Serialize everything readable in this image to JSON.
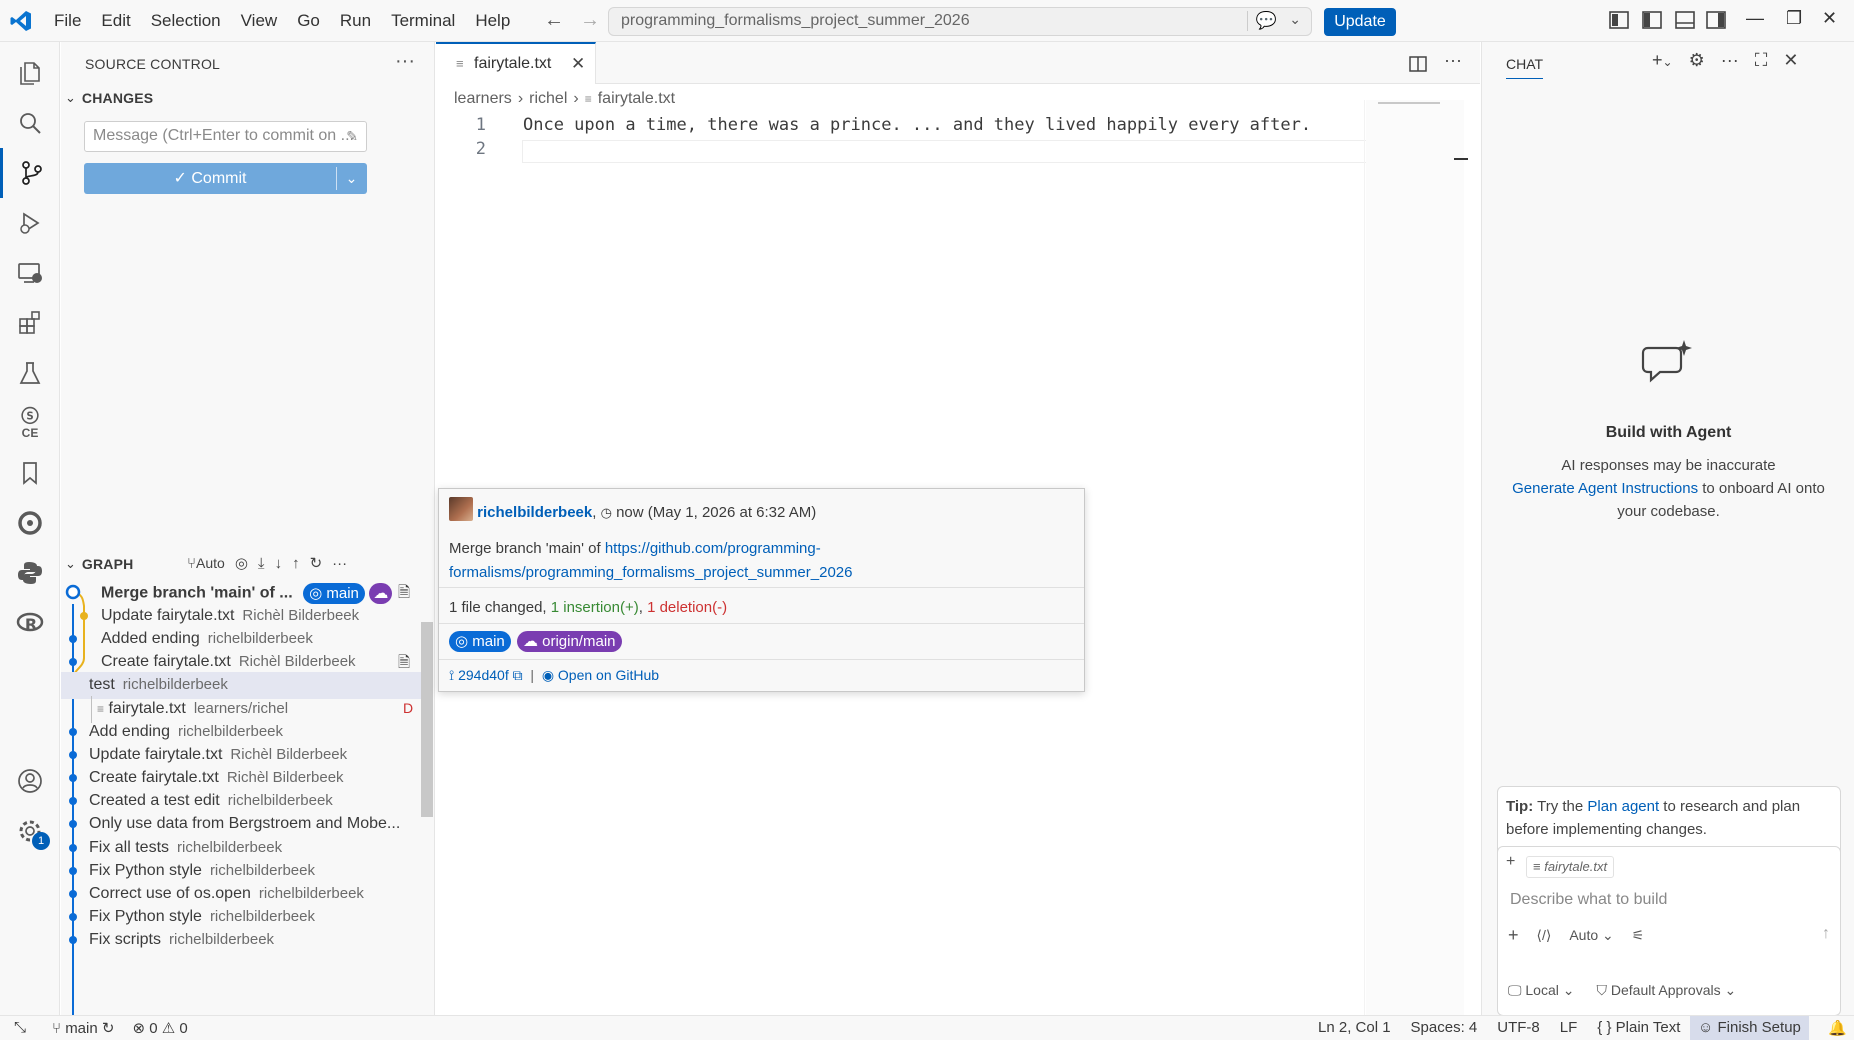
{
  "titlebar": {
    "menu": [
      "File",
      "Edit",
      "Selection",
      "View",
      "Go",
      "Run",
      "Terminal",
      "Help"
    ],
    "search_text": "programming_formalisms_project_summer_2026",
    "update_label": "Update"
  },
  "activitybar": {
    "items": [
      "explorer-icon",
      "search-icon",
      "source-control-icon",
      "run-debug-icon",
      "remote-explorer-icon",
      "extensions-icon",
      "testing-icon",
      "ce-icon",
      "bookmarks-icon",
      "gitlens-icon",
      "python-icon",
      "r-icon"
    ],
    "ce_label": "CE",
    "settings_badge": "1"
  },
  "source_control": {
    "title": "SOURCE CONTROL",
    "changes_label": "CHANGES",
    "message_placeholder": "Message (Ctrl+Enter to commit on ...",
    "commit_label": "Commit"
  },
  "graph": {
    "title": "GRAPH",
    "auto_label": "Auto",
    "rows": [
      {
        "msg": "Merge branch 'main' of ...",
        "author": "",
        "bold": true
      },
      {
        "msg": "Update fairytale.txt",
        "author": "Richèl Bilderbeek"
      },
      {
        "msg": "Added ending",
        "author": "richelbilderbeek"
      },
      {
        "msg": "Create fairytale.txt",
        "author": "Richèl Bilderbeek"
      },
      {
        "msg": "test",
        "author": "richelbilderbeek"
      },
      {
        "msg": "fairytale.txt",
        "author": "learners/richel",
        "status": "D"
      },
      {
        "msg": "Add ending",
        "author": "richelbilderbeek"
      },
      {
        "msg": "Update fairytale.txt",
        "author": "Richèl Bilderbeek"
      },
      {
        "msg": "Create fairytale.txt",
        "author": "Richèl Bilderbeek"
      },
      {
        "msg": "Created a test edit",
        "author": "richelbilderbeek"
      },
      {
        "msg": "Only use data from Bergstroem and Mobe...",
        "author": ""
      },
      {
        "msg": "Fix all tests",
        "author": "richelbilderbeek"
      },
      {
        "msg": "Fix Python style",
        "author": "richelbilderbeek"
      },
      {
        "msg": "Correct use of os.open",
        "author": "richelbilderbeek"
      },
      {
        "msg": "Fix Python style",
        "author": "richelbilderbeek"
      },
      {
        "msg": "Fix scripts",
        "author": "richelbilderbeek"
      }
    ],
    "branch_pill": "main"
  },
  "editor": {
    "tab_label": "fairytale.txt",
    "breadcrumb": [
      "learners",
      "richel",
      "fairytale.txt"
    ],
    "line_numbers": [
      "1",
      "2"
    ],
    "lines": [
      "Once upon a time, there was a prince. ... and they lived happily every after.",
      ""
    ]
  },
  "hover": {
    "author": "richelbilderbeek",
    "time": "now (May 1, 2026 at 6:32 AM)",
    "message_prefix": "Merge branch 'main' of ",
    "link_line1": "https://github.com/programming-",
    "link_line2": "formalisms/programming_formalisms_project_summer_2026",
    "files_changed": "1 file changed, ",
    "insertions": "1 insertion(+)",
    "sep": ", ",
    "deletions": "1 deletion(-)",
    "branch": "main",
    "remote": "origin/main",
    "sha": "294d40f",
    "open_label": "Open on GitHub"
  },
  "chat": {
    "title": "CHAT",
    "heading": "Build with Agent",
    "desc_1": "AI responses may be inaccurate",
    "desc_link": "Generate Agent Instructions",
    "desc_2": " to onboard AI onto your codebase.",
    "tip_label": "Tip:",
    "tip_1": " Try the ",
    "tip_link": "Plan agent",
    "tip_2": " to research and plan before implementing changes.",
    "attached_file": "fairytale.txt",
    "input_placeholder": "Describe what to build",
    "mode_label": "Auto",
    "footer_local": "Local",
    "footer_approvals": "Default Approvals"
  },
  "statusbar": {
    "branch": "main",
    "errors": "0",
    "warnings": "0",
    "position": "Ln 2, Col 1",
    "spaces": "Spaces: 4",
    "encoding": "UTF-8",
    "eol": "LF",
    "language": "Plain Text",
    "finish": "Finish Setup"
  },
  "colors": {
    "accent": "#005fb8",
    "main_pill": "#0a6bd6",
    "origin_pill": "#7a3db1",
    "graph_blue": "#0a6bd6",
    "graph_yellow": "#e8b21e"
  }
}
